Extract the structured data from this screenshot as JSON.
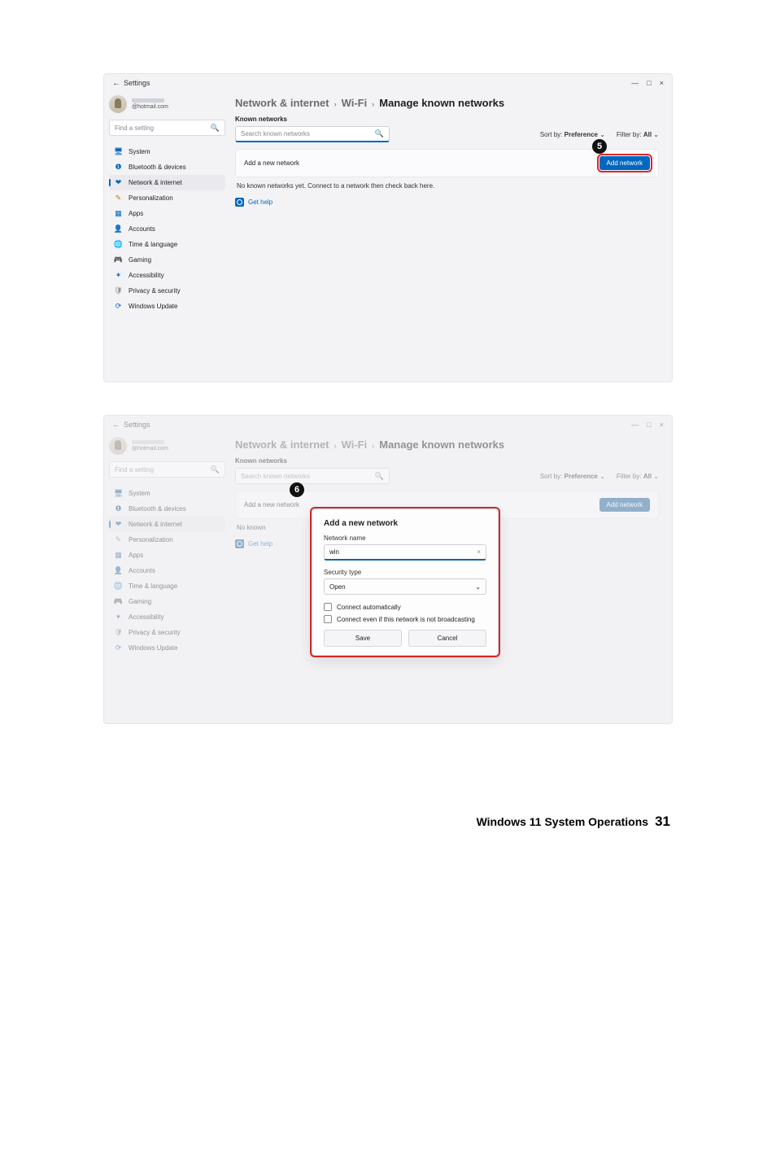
{
  "window": {
    "back": "←",
    "title": "Settings",
    "controls": {
      "min": "—",
      "max": "□",
      "close": "×"
    }
  },
  "user": {
    "email": "@hotmail.com"
  },
  "search_sidebar": {
    "placeholder": "Find a setting",
    "icon": "🔍"
  },
  "nav": [
    {
      "icon": "🖥",
      "cls": "ic-sys",
      "label": "System"
    },
    {
      "icon": "❶",
      "cls": "ic-bt",
      "label": "Bluetooth & devices"
    },
    {
      "icon": "❤",
      "cls": "ic-net",
      "label": "Network & internet",
      "active": true
    },
    {
      "icon": "✎",
      "cls": "ic-pers",
      "label": "Personalization"
    },
    {
      "icon": "▦",
      "cls": "ic-apps",
      "label": "Apps"
    },
    {
      "icon": "👤",
      "cls": "ic-acc",
      "label": "Accounts"
    },
    {
      "icon": "🌐",
      "cls": "ic-time",
      "label": "Time & language"
    },
    {
      "icon": "🎮",
      "cls": "ic-game",
      "label": "Gaming"
    },
    {
      "icon": "✶",
      "cls": "ic-accs",
      "label": "Accessibility"
    },
    {
      "icon": "🛡",
      "cls": "ic-priv",
      "label": "Privacy & security"
    },
    {
      "icon": "⟳",
      "cls": "ic-upd",
      "label": "Windows Update"
    }
  ],
  "breadcrumb": {
    "a": "Network & internet",
    "b": "Wi-Fi",
    "c": "Manage known networks",
    "sep": "›"
  },
  "section_title": "Known networks",
  "search_main": {
    "placeholder": "Search known networks",
    "icon": "🔍"
  },
  "filters": {
    "sort_label": "Sort by:",
    "sort_value": "Preference",
    "filter_label": "Filter by:",
    "filter_value": "All",
    "chev": "⌄"
  },
  "card": {
    "label": "Add a new network",
    "button": "Add network"
  },
  "empty": "No known networks yet. Connect to a network then check back here.",
  "get_help": "Get help",
  "callouts": {
    "five": "5",
    "six": "6"
  },
  "dialog": {
    "title": "Add a new network",
    "name_label": "Network name",
    "name_value": "win",
    "clear": "×",
    "sec_label": "Security type",
    "sec_value": "Open",
    "chev": "⌄",
    "chk1": "Connect automatically",
    "chk2": "Connect even if this network is not broadcasting",
    "save": "Save",
    "cancel": "Cancel",
    "partial_empty": "No known"
  },
  "footer": {
    "title": "Windows 11 System Operations",
    "page": "31"
  }
}
